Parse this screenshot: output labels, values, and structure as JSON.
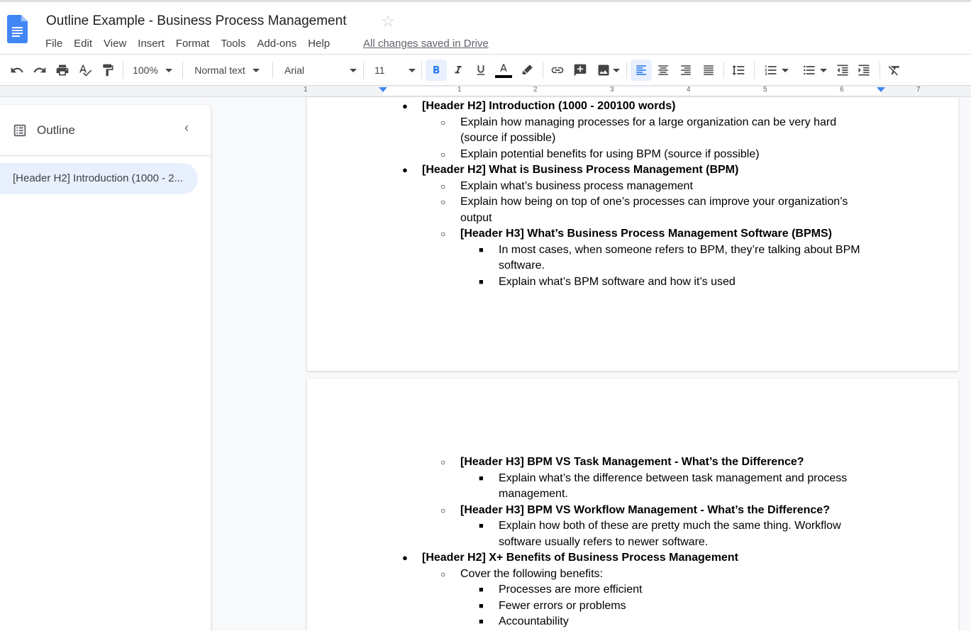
{
  "doc": {
    "title": "Outline Example - Business Process Management",
    "saved_status": "All changes saved in Drive"
  },
  "menu": [
    "File",
    "Edit",
    "View",
    "Insert",
    "Format",
    "Tools",
    "Add-ons",
    "Help"
  ],
  "toolbar": {
    "zoom": "100%",
    "style": "Normal text",
    "font": "Arial",
    "font_size": "11"
  },
  "ruler": {
    "numbers": [
      "1",
      "1",
      "2",
      "3",
      "4",
      "5",
      "6",
      "7"
    ]
  },
  "outline": {
    "title": "Outline",
    "items": [
      "[Header H2] Introduction (1000 - 2..."
    ]
  },
  "page1": {
    "lines": [
      {
        "bullet": "●",
        "text": "[Header H2] Introduction (1000 - 200100 words)",
        "bold": true
      },
      {
        "bullet": "○",
        "text": "Explain how managing processes for a large organization can be very hard",
        "bold": false
      },
      {
        "bullet": "",
        "text": "(source if possible)",
        "bold": false
      },
      {
        "bullet": "○",
        "text": "Explain potential benefits for using BPM (source if possible)",
        "bold": false
      },
      {
        "bullet": "●",
        "text": "[Header H2] What is Business Process Management (BPM)",
        "bold": true
      },
      {
        "bullet": "○",
        "text": "Explain what’s business process management",
        "bold": false
      },
      {
        "bullet": "○",
        "text": "Explain how being on top of one’s processes can improve your organization’s",
        "bold": false
      },
      {
        "bullet": "",
        "text": "output",
        "bold": false
      },
      {
        "bullet": "○",
        "text": "[Header H3] What’s Business Process Management Software (BPMS)",
        "bold": true
      },
      {
        "bullet": "■",
        "text": "In most cases, when someone refers to BPM, they’re talking about BPM",
        "bold": false
      },
      {
        "bullet": "",
        "text": "software.",
        "bold": false
      },
      {
        "bullet": "■",
        "text": "Explain what’s BPM software and how it’s used",
        "bold": false
      }
    ]
  },
  "page2": {
    "lines": [
      {
        "bullet": "○",
        "text": "[Header H3] BPM VS Task Management - What’s the Difference?",
        "bold": true
      },
      {
        "bullet": "■",
        "text": "Explain what’s the difference between task management and process",
        "bold": false
      },
      {
        "bullet": "",
        "text": "management.",
        "bold": false
      },
      {
        "bullet": "○",
        "text": "[Header H3] BPM VS Workflow Management - What’s the Difference?",
        "bold": true
      },
      {
        "bullet": "■",
        "text": "Explain how both of these are pretty much the same thing. Workflow",
        "bold": false
      },
      {
        "bullet": "",
        "text": "software usually refers to newer software.",
        "bold": false
      },
      {
        "bullet": "●",
        "text": "[Header H2] X+ Benefits of Business Process Management",
        "bold": true
      },
      {
        "bullet": "○",
        "text": "Cover the following benefits:",
        "bold": false
      },
      {
        "bullet": "■",
        "text": "Processes are more efficient",
        "bold": false
      },
      {
        "bullet": "■",
        "text": "Fewer errors or problems",
        "bold": false
      },
      {
        "bullet": "■",
        "text": "Accountability",
        "bold": false
      }
    ]
  },
  "colors": {
    "accent": "#1a73e8",
    "selected_bg": "#e8f0fe",
    "docs_blue": "#4285f4"
  }
}
